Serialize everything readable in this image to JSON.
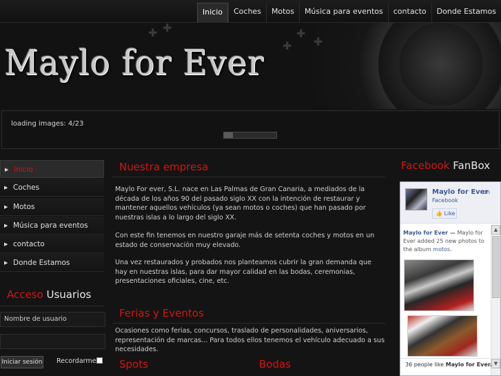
{
  "nav": {
    "items": [
      {
        "label": "Inicio",
        "active": true
      },
      {
        "label": "Coches",
        "active": false
      },
      {
        "label": "Motos",
        "active": false
      },
      {
        "label": "Música para eventos",
        "active": false
      },
      {
        "label": "contacto",
        "active": false
      },
      {
        "label": "Donde Estamos",
        "active": false
      }
    ]
  },
  "header": {
    "logo": "Maylo for Ever"
  },
  "slideshow": {
    "loading_text": "loading images: 4/23",
    "progress": 0.17
  },
  "sidebar": {
    "items": [
      {
        "label": "Inicio",
        "active": true
      },
      {
        "label": "Coches",
        "active": false
      },
      {
        "label": "Motos",
        "active": false
      },
      {
        "label": "Música para eventos",
        "active": false
      },
      {
        "label": "contacto",
        "active": false
      },
      {
        "label": "Donde Estamos",
        "active": false
      }
    ]
  },
  "login": {
    "title_red": "Acceso",
    "title_white": "Usuarios",
    "username_placeholder": "Nombre de usuario",
    "password_placeholder": "",
    "button": "Iniciar sesión",
    "remember": "Recordarme"
  },
  "main": {
    "company_title": "Nuestra empresa",
    "company_paragraphs": [
      "Maylo For ever, S.L. nace en Las Palmas de Gran Canaria, a mediados de la década de los años 90 del pasado siglo XX con la intención de restaurar y mantener aquellos vehículos (ya sean motos o coches) que han pasado por nuestras islas a lo largo del siglo XX.",
      "Con este fin tenemos en nuestro garaje más de setenta coches y motos en un estado de conservación muy elevado.",
      "Una vez restaurados y probados nos planteamos cubrir la gran demanda que hay en nuestras islas, para dar mayor calidad en las bodas, ceremonias, presentaciones oficiales, cine, etc."
    ],
    "fairs_title": "Ferias y Eventos",
    "fairs_text": "Ocasiones como ferias, concursos, traslado de personalidades, aniversarios, representación de marcas... Para todos ellos tenemos el vehículo adecuado a sus necesidades.",
    "spots_title": "Spots",
    "weddings_title": "Bodas"
  },
  "fanbox": {
    "title_red": "Facebook",
    "title_white": "FanBox",
    "page_name": "Maylo for Ever",
    "on": "on",
    "facebook": "Facebook",
    "like": "Like",
    "post_author": "Maylo for Ever —",
    "post_text_1": "Maylo for Ever added 25 new photos to the album",
    "post_album": "motos",
    "likes_text": "36 people like",
    "likes_page": "Maylo for Ever."
  },
  "colors": {
    "accent": "#d41414",
    "background": "#141414",
    "facebook_blue": "#3b5998"
  }
}
